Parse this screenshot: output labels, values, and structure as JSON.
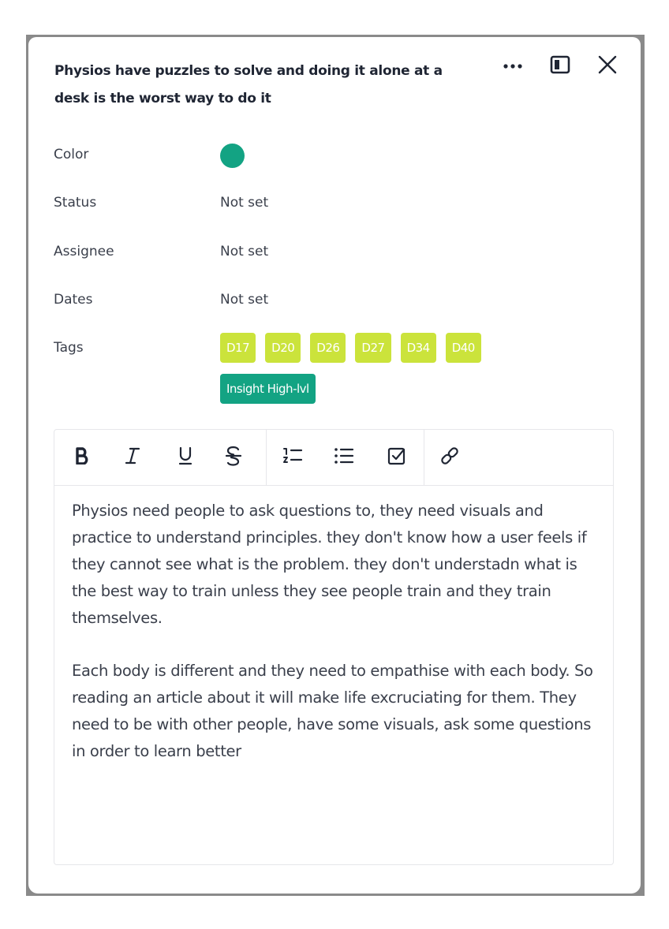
{
  "card": {
    "title": "Physios have puzzles to solve and doing it alone at a desk is the worst way to do it",
    "header_actions": {
      "more_icon": "more-horizontal-icon",
      "panel_icon": "side-panel-icon",
      "close_icon": "close-icon"
    }
  },
  "fields": {
    "color": {
      "label": "Color",
      "value_color": "#13a383"
    },
    "status": {
      "label": "Status",
      "value": "Not set"
    },
    "assignee": {
      "label": "Assignee",
      "value": "Not set"
    },
    "dates": {
      "label": "Dates",
      "value": "Not set"
    },
    "tags": {
      "label": "Tags",
      "items": [
        {
          "text": "D17",
          "color": "#cbe33b"
        },
        {
          "text": "D20",
          "color": "#cbe33b"
        },
        {
          "text": "D26",
          "color": "#cbe33b"
        },
        {
          "text": "D27",
          "color": "#cbe33b"
        },
        {
          "text": "D34",
          "color": "#cbe33b"
        },
        {
          "text": "D40",
          "color": "#cbe33b"
        },
        {
          "text": "Insight High-lvl",
          "color": "#13a383"
        }
      ]
    }
  },
  "editor": {
    "toolbar": [
      "bold-icon",
      "italic-icon",
      "underline-icon",
      "strikethrough-icon",
      "numbered-list-icon",
      "bullet-list-icon",
      "checklist-icon",
      "link-icon"
    ],
    "paragraphs": [
      "Physios need people to ask questions to, they need visuals and practice to understand principles. they don't know how a user feels if they cannot see what is the problem. they don't understadn what is the best way to train unless they see people train and they train themselves.",
      "Each body is different and they need to empathise with each body. So reading an article about it will make life excruciating for them. They need to be with other people, have some visuals, ask some questions in order to learn better"
    ]
  }
}
